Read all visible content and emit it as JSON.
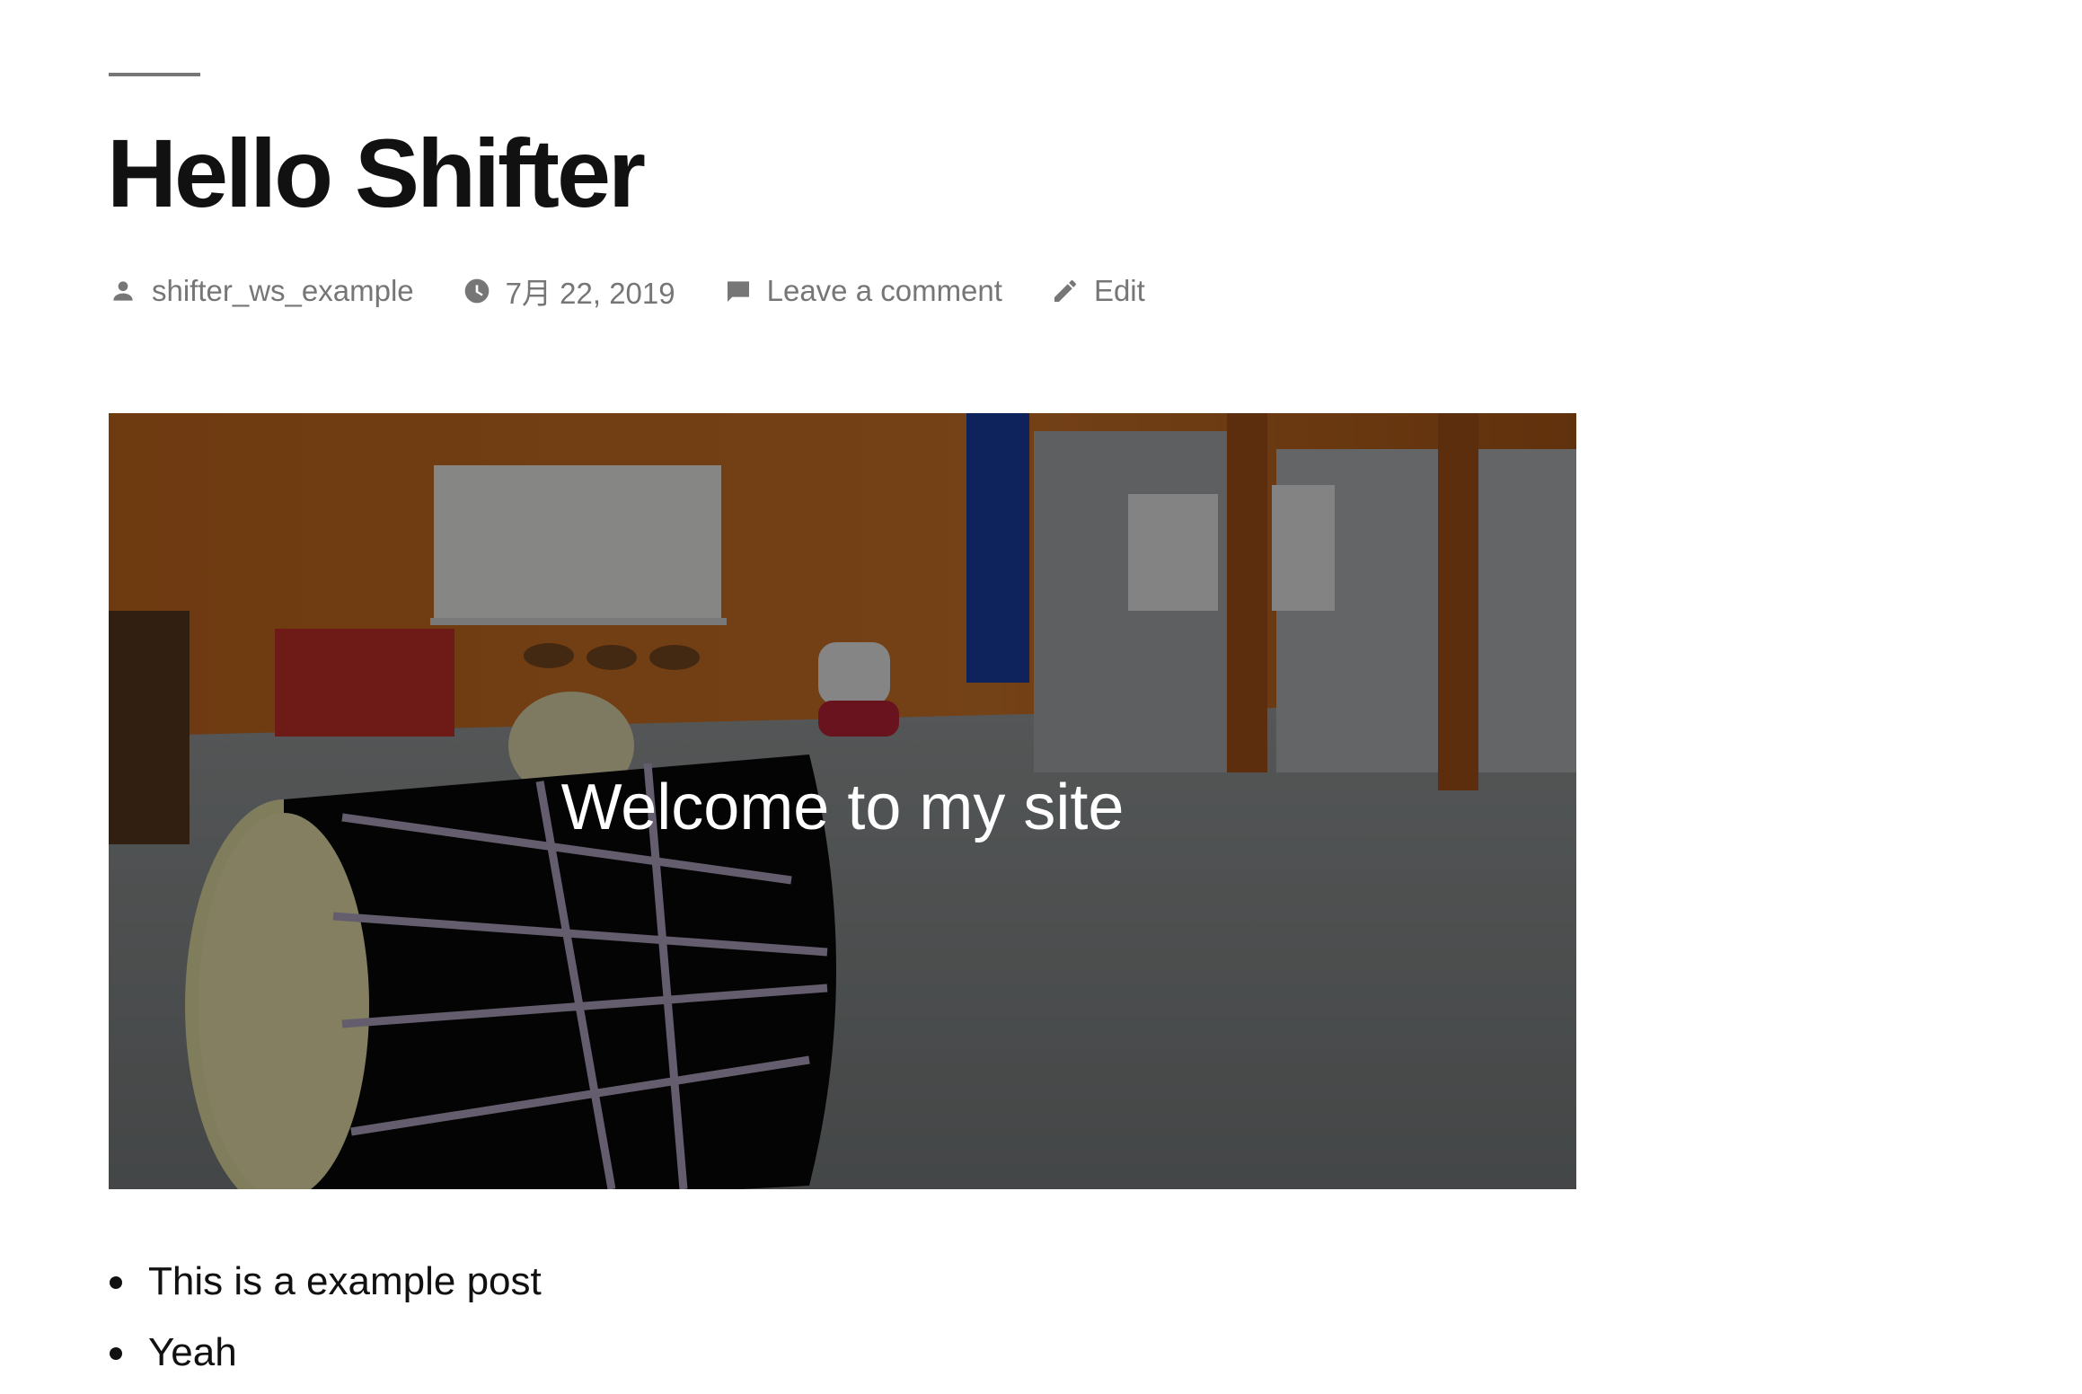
{
  "post": {
    "title": "Hello Shifter",
    "meta": {
      "author": "shifter_ws_example",
      "date": "7月 22, 2019",
      "comments": "Leave a comment",
      "edit": "Edit"
    },
    "cover": {
      "title": "Welcome to my site",
      "overlay_color": "#000000"
    },
    "content_list": [
      "This is a example post",
      "Yeah"
    ]
  },
  "icons": {
    "author": "person-icon",
    "date": "clock-icon",
    "comments": "comment-icon",
    "edit": "pencil-icon"
  },
  "colors": {
    "text": "#111111",
    "meta": "#767676",
    "background": "#ffffff"
  }
}
